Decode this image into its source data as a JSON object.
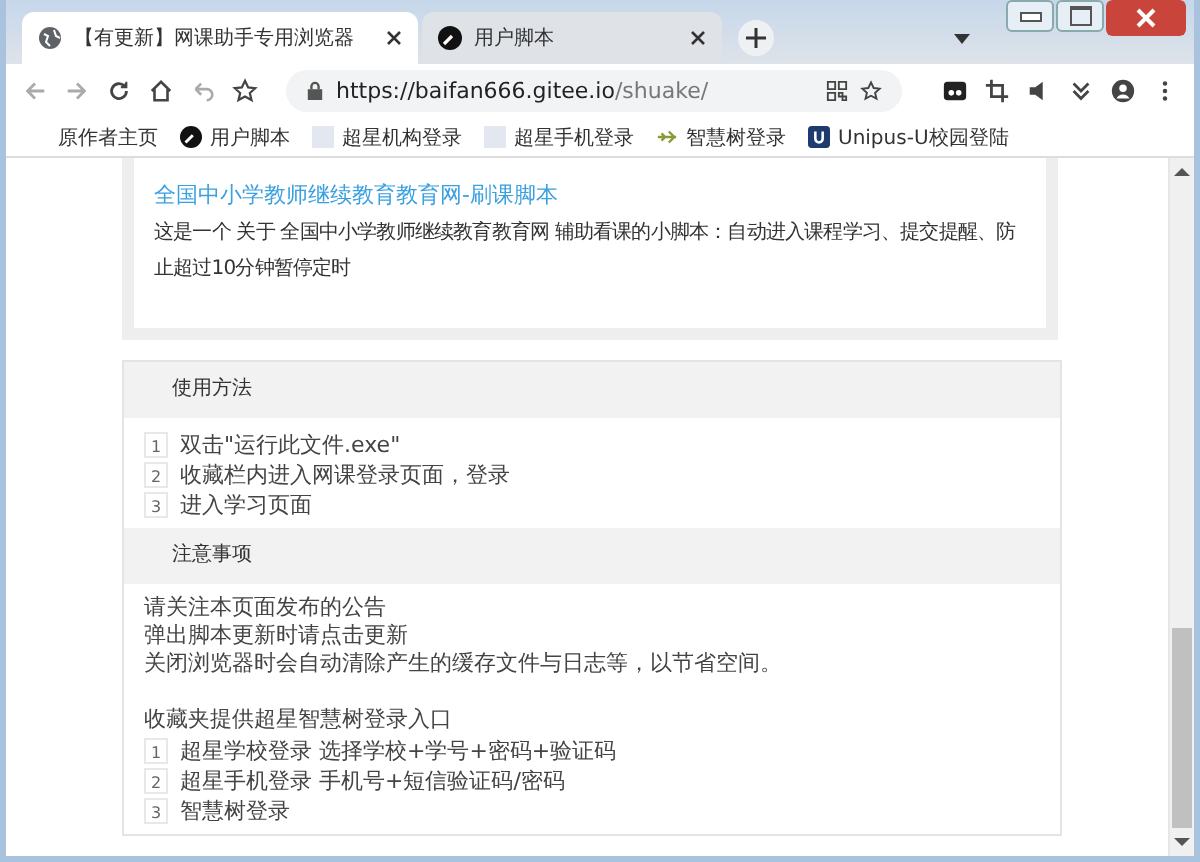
{
  "tabs": [
    {
      "title": "【有更新】网课助手专用浏览器",
      "selected": true,
      "kind": "globe"
    },
    {
      "title": "用户脚本",
      "selected": false,
      "kind": "script"
    }
  ],
  "address": {
    "host": "https://baifan666.gitee.io",
    "path": "/shuake/"
  },
  "bookmarks": [
    {
      "label": "原作者主页",
      "kind": "none"
    },
    {
      "label": "用户脚本",
      "kind": "script"
    },
    {
      "label": "超星机构登录",
      "kind": "blank"
    },
    {
      "label": "超星手机登录",
      "kind": "blank"
    },
    {
      "label": "智慧树登录",
      "kind": "plane"
    },
    {
      "label": "Unipus-U校园登陆",
      "kind": "u"
    }
  ],
  "script_card": {
    "title": "全国中小学教师继续教育教育网-刷课脚本",
    "description": "这是一个 关于 全国中小学教师继续教育教育网 辅助看课的小脚本：自动进入课程学习、提交提醒、防止超过10分钟暂停定时"
  },
  "sections": [
    {
      "heading": "使用方法",
      "blocks": [
        {
          "kind": "steps",
          "items": [
            {
              "num": "1",
              "text": "双击\"运行此文件.exe\""
            },
            {
              "num": "2",
              "text": "收藏栏内进入网课登录页面，登录"
            },
            {
              "num": "3",
              "text": "进入学习页面"
            }
          ]
        }
      ]
    },
    {
      "heading": "注意事项",
      "blocks": [
        {
          "kind": "lines",
          "lines": [
            "请关注本页面发布的公告",
            "弹出脚本更新时请点击更新",
            "关闭浏览器时会自动清除产生的缓存文件与日志等，以节省空间。"
          ]
        },
        {
          "kind": "steps",
          "intro": "收藏夹提供超星智慧树登录入口",
          "items": [
            {
              "num": "1",
              "text": "超星学校登录 选择学校+学号+密码+验证码"
            },
            {
              "num": "2",
              "text": "超星手机登录 手机号+短信验证码/密码"
            },
            {
              "num": "3",
              "text": "智慧树登录"
            }
          ]
        }
      ]
    }
  ]
}
